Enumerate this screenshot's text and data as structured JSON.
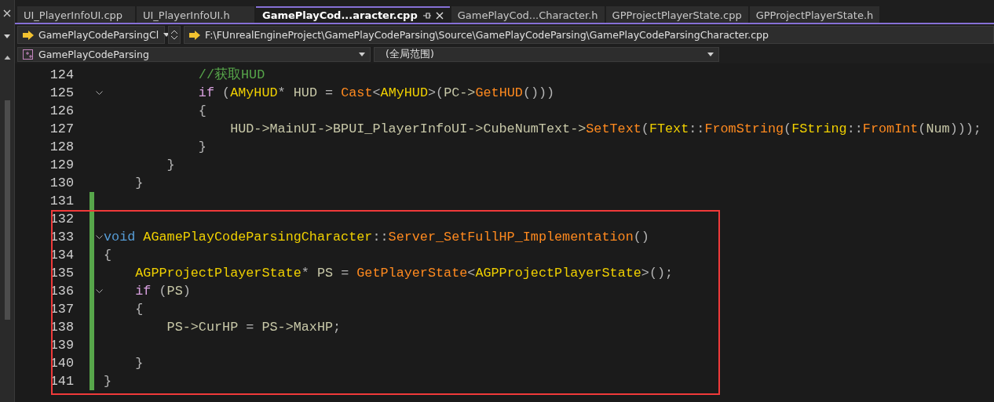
{
  "tabs": [
    {
      "label": "UI_PlayerInfoUI.cpp",
      "selected": false
    },
    {
      "label": "UI_PlayerInfoUI.h",
      "selected": false
    },
    {
      "label": "GamePlayCod...aracter.cpp",
      "selected": true
    },
    {
      "label": "GamePlayCod...Character.h",
      "selected": false
    },
    {
      "label": "GPProjectPlayerState.cpp",
      "selected": false
    },
    {
      "label": "GPProjectPlayerState.h",
      "selected": false
    }
  ],
  "navigation": {
    "scope": "GamePlayCodeParsingCl",
    "file_path": "F:\\FUnrealEngineProject\\GamePlayCodeParsing\\Source\\GamePlayCodeParsing\\GamePlayCodeParsingCharacter.cpp"
  },
  "member_bar": {
    "project": "GamePlayCodeParsing",
    "scope": "(全局范围)"
  },
  "code_lines": [
    {
      "number": "124",
      "foldable": false,
      "changed": false,
      "tokens": [
        {
          "kind": "comment",
          "text": "            //获取HUD"
        }
      ]
    },
    {
      "number": "125",
      "foldable": true,
      "changed": false,
      "tokens": [
        {
          "kind": "control",
          "text": "            if"
        },
        {
          "kind": "punct",
          "text": " ("
        },
        {
          "kind": "type",
          "text": "AMyHUD"
        },
        {
          "kind": "punct",
          "text": "* "
        },
        {
          "kind": "variable",
          "text": "HUD"
        },
        {
          "kind": "punct",
          "text": " = "
        },
        {
          "kind": "function",
          "text": "Cast"
        },
        {
          "kind": "punct",
          "text": "<"
        },
        {
          "kind": "type",
          "text": "AMyHUD"
        },
        {
          "kind": "punct",
          "text": ">("
        },
        {
          "kind": "variable",
          "text": "PC->"
        },
        {
          "kind": "function",
          "text": "GetHUD"
        },
        {
          "kind": "punct",
          "text": "()))"
        }
      ]
    },
    {
      "number": "126",
      "foldable": false,
      "changed": false,
      "tokens": [
        {
          "kind": "punct",
          "text": "            {"
        }
      ]
    },
    {
      "number": "127",
      "foldable": false,
      "changed": false,
      "tokens": [
        {
          "kind": "variable",
          "text": "                HUD->MainUI->BPUI_PlayerInfoUI->CubeNumText->"
        },
        {
          "kind": "function",
          "text": "SetText"
        },
        {
          "kind": "punct",
          "text": "("
        },
        {
          "kind": "type",
          "text": "FText"
        },
        {
          "kind": "punct",
          "text": "::"
        },
        {
          "kind": "function",
          "text": "FromString"
        },
        {
          "kind": "punct",
          "text": "("
        },
        {
          "kind": "type",
          "text": "FString"
        },
        {
          "kind": "punct",
          "text": "::"
        },
        {
          "kind": "function",
          "text": "FromInt"
        },
        {
          "kind": "punct",
          "text": "("
        },
        {
          "kind": "variable",
          "text": "Num"
        },
        {
          "kind": "punct",
          "text": ")));"
        }
      ]
    },
    {
      "number": "128",
      "foldable": false,
      "changed": false,
      "tokens": [
        {
          "kind": "punct",
          "text": "            }"
        }
      ]
    },
    {
      "number": "129",
      "foldable": false,
      "changed": false,
      "tokens": [
        {
          "kind": "punct",
          "text": "        }"
        }
      ]
    },
    {
      "number": "130",
      "foldable": false,
      "changed": false,
      "tokens": [
        {
          "kind": "punct",
          "text": "    }"
        }
      ]
    },
    {
      "number": "131",
      "foldable": false,
      "changed": true
    },
    {
      "number": "132",
      "foldable": false,
      "changed": true
    },
    {
      "number": "133",
      "foldable": true,
      "changed": true,
      "tokens": [
        {
          "kind": "keyword",
          "text": "void "
        },
        {
          "kind": "type",
          "text": "AGamePlayCodeParsingCharacter"
        },
        {
          "kind": "punct",
          "text": "::"
        },
        {
          "kind": "function",
          "text": "Server_SetFullHP_Implementation"
        },
        {
          "kind": "punct",
          "text": "()"
        }
      ]
    },
    {
      "number": "134",
      "foldable": false,
      "changed": true,
      "tokens": [
        {
          "kind": "punct",
          "text": "{"
        }
      ]
    },
    {
      "number": "135",
      "foldable": false,
      "changed": true,
      "tokens": [
        {
          "kind": "type",
          "text": "    AGPProjectPlayerState"
        },
        {
          "kind": "punct",
          "text": "* "
        },
        {
          "kind": "variable",
          "text": "PS"
        },
        {
          "kind": "punct",
          "text": " = "
        },
        {
          "kind": "function",
          "text": "GetPlayerState"
        },
        {
          "kind": "punct",
          "text": "<"
        },
        {
          "kind": "type",
          "text": "AGPProjectPlayerState"
        },
        {
          "kind": "punct",
          "text": ">();"
        }
      ]
    },
    {
      "number": "136",
      "foldable": true,
      "changed": true,
      "tokens": [
        {
          "kind": "control",
          "text": "    if"
        },
        {
          "kind": "punct",
          "text": " ("
        },
        {
          "kind": "variable",
          "text": "PS"
        },
        {
          "kind": "punct",
          "text": ")"
        }
      ]
    },
    {
      "number": "137",
      "foldable": false,
      "changed": true,
      "tokens": [
        {
          "kind": "punct",
          "text": "    {"
        }
      ]
    },
    {
      "number": "138",
      "foldable": false,
      "changed": true,
      "tokens": [
        {
          "kind": "variable",
          "text": "        PS->CurHP"
        },
        {
          "kind": "punct",
          "text": " = "
        },
        {
          "kind": "variable",
          "text": "PS->MaxHP"
        },
        {
          "kind": "punct",
          "text": ";"
        }
      ]
    },
    {
      "number": "139",
      "foldable": false,
      "changed": true
    },
    {
      "number": "140",
      "foldable": false,
      "changed": true,
      "tokens": [
        {
          "kind": "punct",
          "text": "    }"
        }
      ]
    },
    {
      "number": "141",
      "foldable": false,
      "changed": true,
      "tokens": [
        {
          "kind": "punct",
          "text": "}"
        }
      ]
    }
  ]
}
